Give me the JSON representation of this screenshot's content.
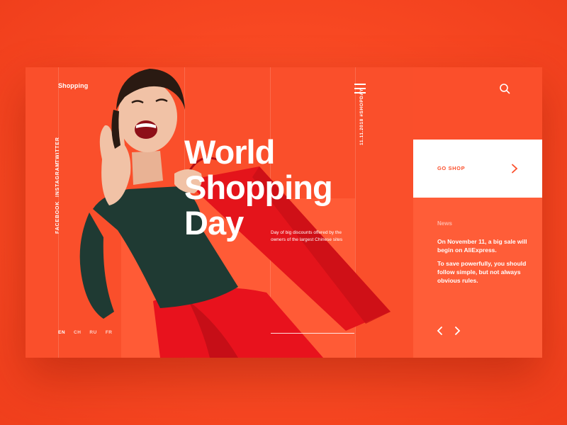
{
  "header": {
    "brand": "Shopping"
  },
  "social": [
    "FACEBOOK",
    "INSTAGRAM",
    "TWITTER"
  ],
  "languages": {
    "items": [
      "EN",
      "CH",
      "RU",
      "FR"
    ],
    "active": "EN"
  },
  "hero": {
    "title_lines": [
      "World",
      "Shopping",
      "Day"
    ],
    "description": "Day of big discounts offered by the owners of the largest Chinese sites",
    "date_tag": "11.11.2018  #SHOPDAY"
  },
  "cta": {
    "label": "GO SHOP"
  },
  "news": {
    "title": "News",
    "paragraphs": [
      "On November 11, a big sale will begin on AliExpress.",
      "To save powerfully, you should follow simple, but not always obvious rules."
    ]
  },
  "icons": {
    "menu": "hamburger-menu-icon",
    "search": "search-icon",
    "cta_arrow": "chevron-right-icon",
    "prev": "chevron-left-icon",
    "next": "chevron-right-icon"
  },
  "colors": {
    "accent": "#fb4f2b",
    "background": "#fb4b25",
    "white": "#ffffff"
  }
}
